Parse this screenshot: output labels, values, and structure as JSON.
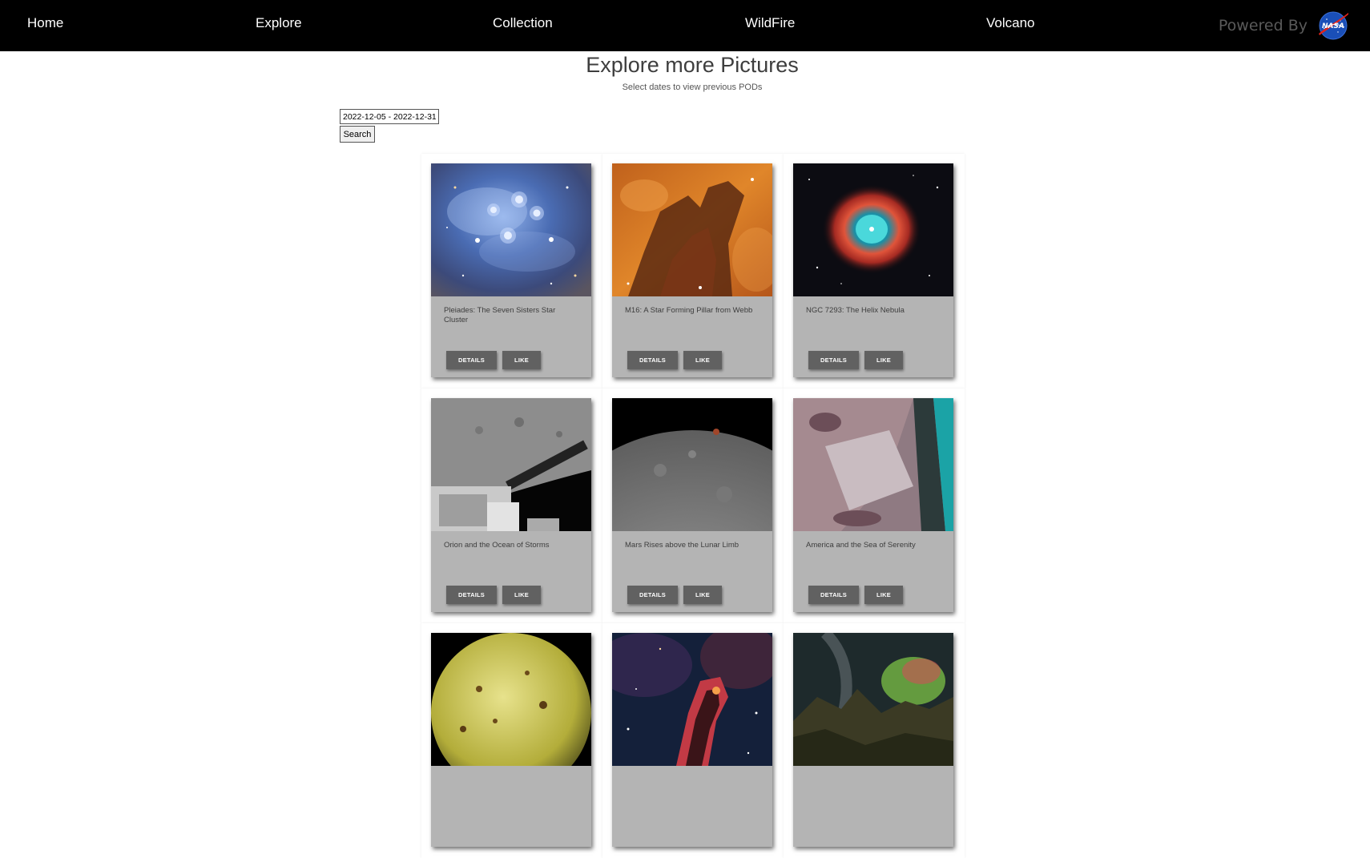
{
  "nav": {
    "items": [
      "Home",
      "Explore",
      "Collection",
      "WildFire",
      "Volcano"
    ],
    "powered_by": "Powered By",
    "logo_text": "NASA"
  },
  "page": {
    "title": "Explore more Pictures",
    "subtitle": "Select dates to view previous PODs"
  },
  "search": {
    "date_range": "2022-12-05 - 2022-12-31",
    "button": "Search"
  },
  "card_buttons": {
    "details": "DETAILS",
    "like": "LIKE"
  },
  "cards": [
    {
      "title": "Pleiades: The Seven Sisters Star Cluster"
    },
    {
      "title": "M16: A Star Forming Pillar from Webb"
    },
    {
      "title": "NGC 7293: The Helix Nebula"
    },
    {
      "title": "Orion and the Ocean of Storms"
    },
    {
      "title": "Mars Rises above the Lunar Limb"
    },
    {
      "title": "America and the Sea of Serenity"
    },
    {
      "title": ""
    },
    {
      "title": ""
    },
    {
      "title": ""
    }
  ],
  "colors": {
    "navbar": "#000000",
    "card_bg": "#b4b4b4",
    "button_bg": "#616161"
  }
}
